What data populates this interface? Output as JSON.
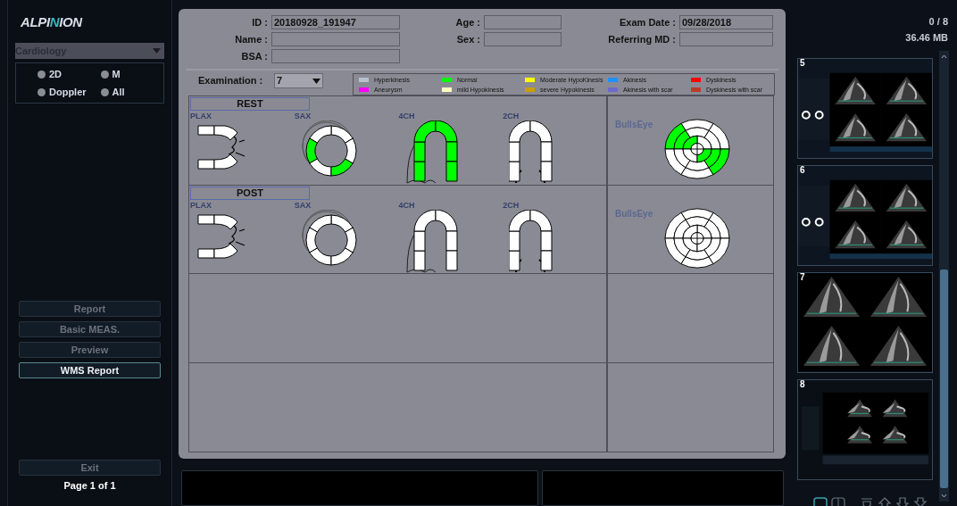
{
  "logo": {
    "text": "ALPI",
    "mark": "N",
    "rest": "ION"
  },
  "sidebar": {
    "preset": "Cardiology",
    "modes": [
      {
        "label": "2D",
        "selected": false
      },
      {
        "label": "M",
        "selected": false
      },
      {
        "label": "Doppler",
        "selected": false
      },
      {
        "label": "All",
        "selected": false
      }
    ],
    "buttons": [
      {
        "label": "Report",
        "disabled": true,
        "selected": false
      },
      {
        "label": "Basic MEAS.",
        "disabled": true,
        "selected": false
      },
      {
        "label": "Preview",
        "disabled": true,
        "selected": false
      },
      {
        "label": "WMS Report",
        "disabled": false,
        "selected": true
      }
    ],
    "exit": {
      "label": "Exit",
      "disabled": true
    },
    "page": "Page 1 of 1"
  },
  "patient_fields": [
    {
      "label": "ID :",
      "value": "20180928_191947"
    },
    {
      "label": "Age :"
    },
    {
      "label": "Exam Date :",
      "value": "09/28/2018"
    },
    {
      "label": "Name :"
    },
    {
      "label": "Sex :"
    },
    {
      "label": "Referring MD :"
    },
    {
      "label": "BSA :"
    }
  ],
  "examination": {
    "label": "Examination :",
    "value": "7"
  },
  "legend": [
    {
      "label": "Hyperkinesis",
      "color": "#b8c0d0"
    },
    {
      "label": "Normal",
      "color": "#00ff00"
    },
    {
      "label": "Moderate HypoKinesis",
      "color": "#ffff00"
    },
    {
      "label": "Akinesis",
      "color": "#1e90ff"
    },
    {
      "label": "Dyskinesis",
      "color": "#ff0000"
    },
    {
      "label": "Aneurysm",
      "color": "#ff00ff"
    },
    {
      "label": "mild Hypokinesis",
      "color": "#ffffc0"
    },
    {
      "label": "severe Hypokinesis",
      "color": "#c8a000"
    },
    {
      "label": "Akinesis with scar",
      "color": "#6a6acd"
    },
    {
      "label": "Dyskinesis with scar",
      "color": "#c0392b"
    }
  ],
  "stages": [
    {
      "label": "REST",
      "views": [
        {
          "label": "PLAX",
          "kind": "plax",
          "segments": [
            {
              "color": "#ffffff"
            },
            {
              "color": "#ffffff"
            },
            {
              "color": "#ffffff"
            },
            {
              "color": "#ffffff"
            }
          ]
        },
        {
          "label": "SAX",
          "kind": "sax",
          "segments": [
            {
              "color": "#ffffff"
            },
            {
              "color": "#ffffff"
            },
            {
              "color": "#ffffff"
            },
            {
              "color": "#00ff00"
            },
            {
              "color": "#ffffff"
            },
            {
              "color": "#00ff00"
            }
          ]
        },
        {
          "label": "4CH",
          "kind": "chamber",
          "segments": [
            {
              "color": "#00ff00"
            },
            {
              "color": "#00ff00"
            },
            {
              "color": "#00ff00"
            },
            {
              "color": "#00ff00"
            },
            {
              "color": "#00ff00"
            },
            {
              "color": "#00ff00"
            }
          ]
        },
        {
          "label": "2CH",
          "kind": "chamber2",
          "segments": [
            {
              "color": "#ffffff"
            },
            {
              "color": "#ffffff"
            },
            {
              "color": "#ffffff"
            },
            {
              "color": "#ffffff"
            },
            {
              "color": "#ffffff"
            },
            {
              "color": "#ffffff"
            }
          ]
        }
      ],
      "bullseye": {
        "label": "BullsEye",
        "segments": [
          {
            "color": "#ffffff"
          },
          {
            "color": "#ffffff"
          },
          {
            "color": "#00ff00"
          },
          {
            "color": "#ffffff"
          },
          {
            "color": "#ffffff"
          },
          {
            "color": "#00ff00"
          },
          {
            "color": "#ffffff"
          },
          {
            "color": "#ffffff"
          },
          {
            "color": "#00ff00"
          },
          {
            "color": "#ffffff"
          },
          {
            "color": "#ffffff"
          },
          {
            "color": "#00ff00"
          },
          {
            "color": "#ffffff"
          },
          {
            "color": "#00ff00"
          },
          {
            "color": "#ffffff"
          },
          {
            "color": "#00ff00"
          },
          {
            "color": "#ffffff"
          }
        ]
      }
    },
    {
      "label": "POST",
      "views": [
        {
          "label": "PLAX",
          "kind": "plax",
          "segments": [
            {
              "color": "#ffffff"
            },
            {
              "color": "#ffffff"
            },
            {
              "color": "#ffffff"
            },
            {
              "color": "#ffffff"
            }
          ]
        },
        {
          "label": "SAX",
          "kind": "sax",
          "segments": [
            {
              "color": "#ffffff"
            },
            {
              "color": "#ffffff"
            },
            {
              "color": "#ffffff"
            },
            {
              "color": "#ffffff"
            },
            {
              "color": "#ffffff"
            },
            {
              "color": "#ffffff"
            }
          ]
        },
        {
          "label": "4CH",
          "kind": "chamber",
          "segments": [
            {
              "color": "#ffffff"
            },
            {
              "color": "#ffffff"
            },
            {
              "color": "#ffffff"
            },
            {
              "color": "#ffffff"
            },
            {
              "color": "#ffffff"
            },
            {
              "color": "#ffffff"
            }
          ]
        },
        {
          "label": "2CH",
          "kind": "chamber2",
          "segments": [
            {
              "color": "#ffffff"
            },
            {
              "color": "#ffffff"
            },
            {
              "color": "#ffffff"
            },
            {
              "color": "#ffffff"
            },
            {
              "color": "#ffffff"
            },
            {
              "color": "#ffffff"
            }
          ]
        }
      ],
      "bullseye": {
        "label": "BullsEye",
        "segments": [
          {
            "color": "#ffffff"
          },
          {
            "color": "#ffffff"
          },
          {
            "color": "#ffffff"
          },
          {
            "color": "#ffffff"
          },
          {
            "color": "#ffffff"
          },
          {
            "color": "#ffffff"
          },
          {
            "color": "#ffffff"
          },
          {
            "color": "#ffffff"
          },
          {
            "color": "#ffffff"
          },
          {
            "color": "#ffffff"
          },
          {
            "color": "#ffffff"
          },
          {
            "color": "#ffffff"
          },
          {
            "color": "#ffffff"
          },
          {
            "color": "#ffffff"
          },
          {
            "color": "#ffffff"
          },
          {
            "color": "#ffffff"
          },
          {
            "color": "#ffffff"
          }
        ]
      }
    }
  ],
  "storage": {
    "count": "0 / 8",
    "size": "36.46 MB"
  },
  "thumbnails": [
    {
      "number": "5",
      "kind": "layout"
    },
    {
      "number": "6",
      "kind": "layout"
    },
    {
      "number": "7",
      "kind": "quad"
    },
    {
      "number": "8",
      "kind": "report"
    }
  ]
}
